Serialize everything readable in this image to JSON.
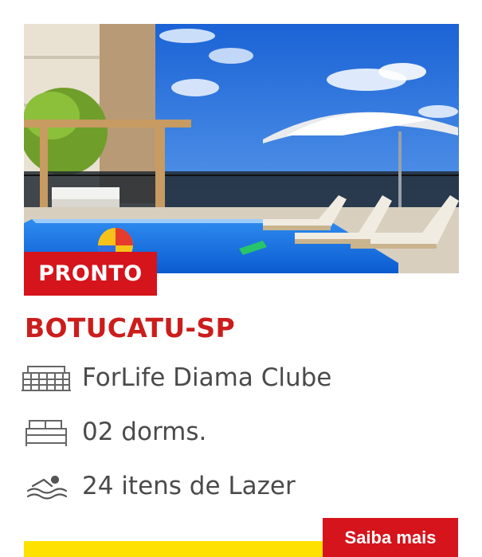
{
  "property_card": {
    "status": "PRONTO",
    "city": "BOTUCATU-SP",
    "features": [
      {
        "icon": "building-icon",
        "text": "ForLife Diama Clube"
      },
      {
        "icon": "bed-icon",
        "text": "02 dorms."
      },
      {
        "icon": "swimmer-icon",
        "text": "24 itens de Lazer"
      }
    ],
    "cta_label": "Saiba mais"
  },
  "colors": {
    "brand_red": "#d5141c",
    "title_red": "#cc1d1d",
    "accent_yellow": "#ffe100",
    "text_gray": "#4a4a4a"
  }
}
